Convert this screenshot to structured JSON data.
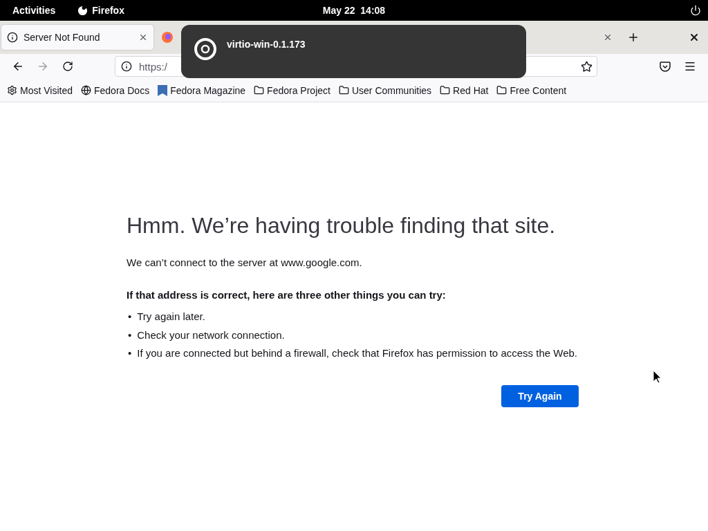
{
  "top_bar": {
    "activities": "Activities",
    "app": "Firefox",
    "clock": "May 22  14:08"
  },
  "tabs": [
    {
      "title": "Server Not Found",
      "selected": true,
      "kind": "info"
    },
    {
      "selected": false,
      "kind": "firefox"
    }
  ],
  "url_bar": {
    "value": "https:/"
  },
  "bookmarks": [
    {
      "label": "Most Visited",
      "kind": "gear"
    },
    {
      "label": "Fedora Docs",
      "kind": "globe"
    },
    {
      "label": "Fedora Magazine",
      "kind": "magazine"
    },
    {
      "label": "Fedora Project",
      "kind": "folder"
    },
    {
      "label": "User Communities",
      "kind": "folder"
    },
    {
      "label": "Red Hat",
      "kind": "folder"
    },
    {
      "label": "Free Content",
      "kind": "folder"
    }
  ],
  "notification": {
    "title": "virtio-win-0.1.173"
  },
  "error_page": {
    "title": "Hmm. We’re having trouble finding that site.",
    "message": "We can’t connect to the server at www.google.com.",
    "suggestion_heading": "If that address is correct, here are three other things you can try:",
    "bullet": "•",
    "suggestions": [
      "Try again later.",
      "Check your network connection.",
      "If you are connected but behind a firewall, check that Firefox has permission to access the Web."
    ],
    "button": "Try Again"
  }
}
